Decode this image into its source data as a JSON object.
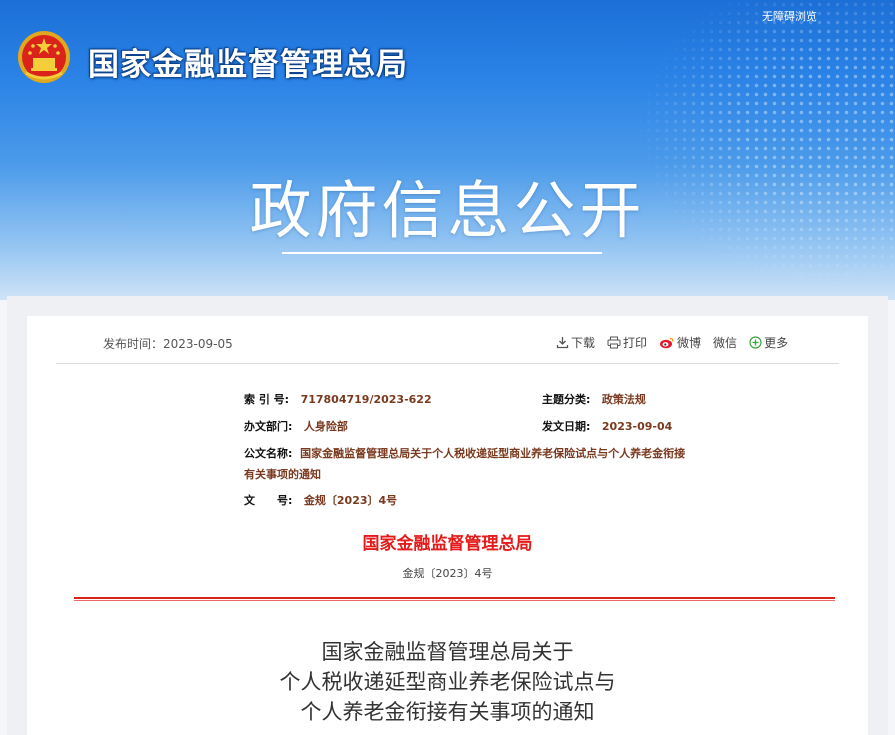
{
  "header": {
    "accessibility_label": "无障碍浏览",
    "agency_name": "国家金融监督管理总局",
    "section_title": "政府信息公开"
  },
  "toolbar": {
    "publish_label": "发布时间：2023-09-05",
    "download": "下载",
    "print": "打印",
    "weibo": "微博",
    "wechat": "微信",
    "more": "更多"
  },
  "meta": {
    "index_label": "索 引 号:",
    "index_value": "717804719/2023-622",
    "topic_label": "主题分类:",
    "topic_value": "政策法规",
    "dept_label": "办文部门:",
    "dept_value": "人身险部",
    "date_label": "发文日期:",
    "date_value": "2023-09-04",
    "name_label": "公文名称:",
    "name_value_line1": "国家金融监督管理总局关于个人税收递延型商业养老保险试点与个人养老金衔接",
    "name_value_line2": "有关事项的通知",
    "docno_label": "文　　号:",
    "docno_value": "金规〔2023〕4号"
  },
  "document": {
    "issuer": "国家金融监督管理总局",
    "doc_number": "金规〔2023〕4号",
    "title_lines": [
      "国家金融监督管理总局关于",
      "个人税收递延型商业养老保险试点与",
      "个人养老金衔接有关事项的通知"
    ]
  },
  "colors": {
    "banner_blue": "#2a82e6",
    "red_accent": "#e51a1a",
    "meta_value": "#7a3a1f"
  }
}
